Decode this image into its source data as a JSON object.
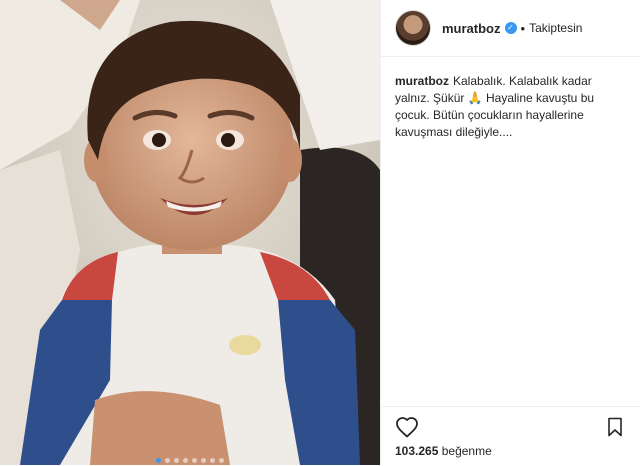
{
  "post": {
    "username": "muratboz",
    "verified": true,
    "follow_status": "Takiptesin",
    "separator": "•",
    "caption": {
      "username": "muratboz",
      "text": "Kalabalık. Kalabalık kadar yalnız. Şükür 🙏 Hayaline kavuştu bu çocuk. Bütün çocukların hayallerine kavuşması dileğiyle...."
    },
    "likes": {
      "count": "103.265",
      "label": "beğenme"
    },
    "carousel": {
      "total": 8,
      "active_index": 0
    }
  },
  "icons": {
    "verified": "verified-badge-icon",
    "like": "heart-icon",
    "save": "bookmark-icon"
  },
  "colors": {
    "accent": "#3897f0",
    "text": "#262626",
    "border": "#efefef"
  }
}
